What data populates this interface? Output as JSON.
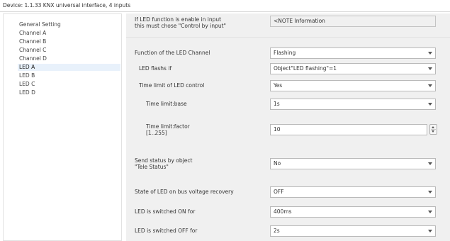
{
  "window": {
    "title": "Device: 1.1.33  KNX universal interface, 4 inputs"
  },
  "sidebar": {
    "items": [
      {
        "label": "General Setting"
      },
      {
        "label": "Channel A"
      },
      {
        "label": "Channel B"
      },
      {
        "label": "Channel C"
      },
      {
        "label": "Channel D"
      },
      {
        "label": "LED A",
        "selected": true
      },
      {
        "label": "LED B"
      },
      {
        "label": "LED C"
      },
      {
        "label": "LED D"
      }
    ]
  },
  "params": {
    "note": {
      "label_line1": "If LED function is enable in input",
      "label_line2": "this must chose \"Control by input\"",
      "value": "<NOTE Information"
    },
    "function": {
      "label": "Function of the LED Channel",
      "value": "Flashing"
    },
    "flashes_if": {
      "label": "LED flashs if",
      "value": "Object\"LED flashing\"=1"
    },
    "time_limit": {
      "label": "Time limit of LED control",
      "value": "Yes"
    },
    "time_base": {
      "label": "Time limit:base",
      "value": "1s"
    },
    "time_factor": {
      "label_line1": "Time limit:factor",
      "label_line2": "[1..255]",
      "value": "10"
    },
    "send_status": {
      "label_line1": "Send status by object",
      "label_line2": "\"Tele Status\"",
      "value": "No"
    },
    "recovery": {
      "label": "State of LED on bus voltage recovery",
      "value": "OFF"
    },
    "on_for": {
      "label": "LED is switched ON for",
      "value": "400ms"
    },
    "off_for": {
      "label": "LED is switched OFF for",
      "value": "2s"
    }
  }
}
